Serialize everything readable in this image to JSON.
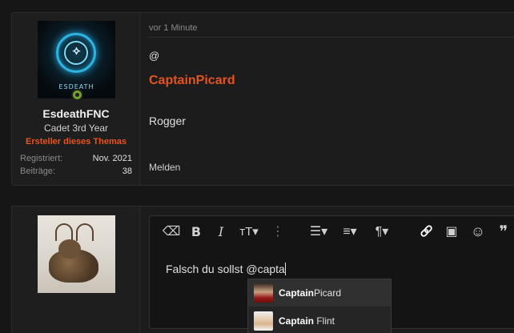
{
  "post": {
    "user": {
      "avatar_text": "ESDEATH",
      "name": "EsdeathFNC",
      "title": "Cadet 3rd Year",
      "badge": "Ersteller dieses Themas",
      "stats": [
        {
          "label": "Registriert:",
          "value": "Nov. 2021"
        },
        {
          "label": "Beiträge:",
          "value": "38"
        }
      ]
    },
    "time": "vor 1 Minute",
    "mention_at": "@",
    "mention_name": "CaptainPicard",
    "body": "Rogger",
    "report": "Melden"
  },
  "editor": {
    "toolbar": [
      {
        "name": "eraser-icon",
        "glyph": "⌫"
      },
      {
        "name": "bold-icon",
        "glyph": "B"
      },
      {
        "name": "italic-icon",
        "glyph": "I"
      },
      {
        "name": "text-size-icon",
        "glyph": "тT▾"
      },
      {
        "name": "more-vertical-icon",
        "glyph": "⋮"
      },
      {
        "name": "list-icon",
        "glyph": "☰▾"
      },
      {
        "name": "align-icon",
        "glyph": "≡▾"
      },
      {
        "name": "paragraph-icon",
        "glyph": "¶▾"
      },
      {
        "name": "link-icon",
        "glyph": "🔗"
      },
      {
        "name": "image-icon",
        "glyph": "▣"
      },
      {
        "name": "emoji-icon",
        "glyph": "☺"
      },
      {
        "name": "quote-icon",
        "glyph": "❞"
      }
    ],
    "text": "Falsch du sollst @capta"
  },
  "suggestions": [
    {
      "match": "Captain",
      "rest": "Picard"
    },
    {
      "match": "Captain",
      "rest": " Flint"
    }
  ],
  "colors": {
    "accent": "#e5531f",
    "online": "#6fa32a",
    "background": "#161616"
  }
}
